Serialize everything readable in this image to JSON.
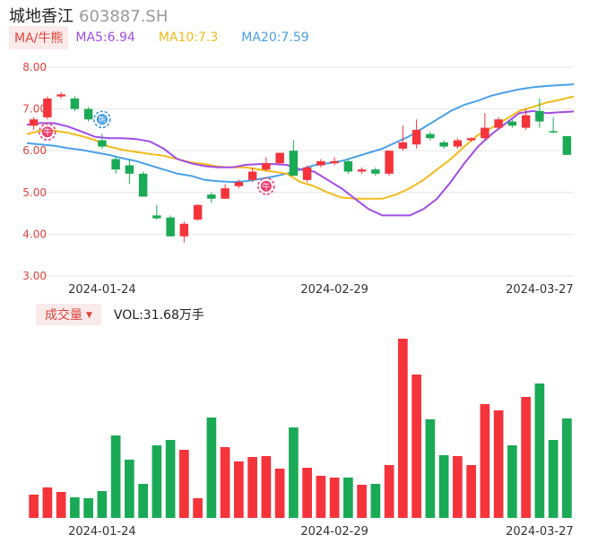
{
  "header": {
    "name": "城地香江",
    "code": "603887.SH",
    "ma_selector": "MA/牛熊",
    "ma5_label": "MA5:6.94",
    "ma10_label": "MA10:7.3",
    "ma20_label": "MA20:7.59"
  },
  "volume_panel": {
    "selector": "成交量",
    "value_label": "VOL:31.68万手"
  },
  "colors": {
    "up": "#f5333b",
    "down": "#1aaa55",
    "ma5": "#a24de6",
    "ma10": "#f2bb1b",
    "ma20": "#4aa0e8",
    "grid": "#e6e6e6",
    "axis_label": "#e0443e"
  },
  "chart_data": {
    "type": "candlestick",
    "y_ticks": [
      "8.00",
      "7.00",
      "6.00",
      "5.00",
      "4.00",
      "3.00"
    ],
    "ylim": [
      3.0,
      8.0
    ],
    "x_tick_labels": [
      "2024-01-24",
      "2024-02-29",
      "2024-03-27"
    ],
    "x_tick_index": [
      5,
      22,
      37
    ],
    "candles": [
      {
        "o": 6.6,
        "c": 6.75,
        "h": 6.8,
        "l": 6.5
      },
      {
        "o": 6.8,
        "c": 7.25,
        "h": 7.3,
        "l": 6.75
      },
      {
        "o": 7.3,
        "c": 7.35,
        "h": 7.4,
        "l": 7.25
      },
      {
        "o": 7.25,
        "c": 7.0,
        "h": 7.3,
        "l": 6.95
      },
      {
        "o": 7.0,
        "c": 6.75,
        "h": 7.05,
        "l": 6.7
      },
      {
        "o": 6.25,
        "c": 6.1,
        "h": 6.4,
        "l": 6.05
      },
      {
        "o": 5.8,
        "c": 5.55,
        "h": 5.85,
        "l": 5.45
      },
      {
        "o": 5.65,
        "c": 5.45,
        "h": 5.8,
        "l": 5.2
      },
      {
        "o": 5.45,
        "c": 4.9,
        "h": 5.5,
        "l": 4.9
      },
      {
        "o": 4.45,
        "c": 4.38,
        "h": 4.7,
        "l": 4.35
      },
      {
        "o": 4.4,
        "c": 3.95,
        "h": 4.45,
        "l": 3.95
      },
      {
        "o": 3.95,
        "c": 4.25,
        "h": 4.3,
        "l": 3.8
      },
      {
        "o": 4.35,
        "c": 4.7,
        "h": 4.72,
        "l": 4.33
      },
      {
        "o": 4.95,
        "c": 4.85,
        "h": 5.0,
        "l": 4.75
      },
      {
        "o": 4.85,
        "c": 5.1,
        "h": 5.2,
        "l": 4.85
      },
      {
        "o": 5.15,
        "c": 5.25,
        "h": 5.3,
        "l": 5.1
      },
      {
        "o": 5.3,
        "c": 5.5,
        "h": 5.6,
        "l": 5.25
      },
      {
        "o": 5.55,
        "c": 5.7,
        "h": 5.85,
        "l": 5.5
      },
      {
        "o": 5.7,
        "c": 5.95,
        "h": 5.95,
        "l": 5.65
      },
      {
        "o": 6.0,
        "c": 5.4,
        "h": 6.25,
        "l": 5.4
      },
      {
        "o": 5.3,
        "c": 5.6,
        "h": 5.65,
        "l": 5.25
      },
      {
        "o": 5.65,
        "c": 5.75,
        "h": 5.8,
        "l": 5.6
      },
      {
        "o": 5.7,
        "c": 5.75,
        "h": 5.85,
        "l": 5.65
      },
      {
        "o": 5.75,
        "c": 5.5,
        "h": 5.8,
        "l": 5.45
      },
      {
        "o": 5.5,
        "c": 5.55,
        "h": 5.6,
        "l": 5.45
      },
      {
        "o": 5.55,
        "c": 5.45,
        "h": 5.6,
        "l": 5.4
      },
      {
        "o": 5.45,
        "c": 6.0,
        "h": 6.0,
        "l": 5.4
      },
      {
        "o": 6.05,
        "c": 6.2,
        "h": 6.6,
        "l": 6.0
      },
      {
        "o": 6.15,
        "c": 6.5,
        "h": 6.75,
        "l": 6.05
      },
      {
        "o": 6.4,
        "c": 6.3,
        "h": 6.45,
        "l": 6.25
      },
      {
        "o": 6.2,
        "c": 6.1,
        "h": 6.25,
        "l": 6.05
      },
      {
        "o": 6.1,
        "c": 6.25,
        "h": 6.3,
        "l": 6.05
      },
      {
        "o": 6.25,
        "c": 6.3,
        "h": 6.32,
        "l": 6.22
      },
      {
        "o": 6.3,
        "c": 6.55,
        "h": 6.9,
        "l": 6.25
      },
      {
        "o": 6.55,
        "c": 6.75,
        "h": 6.8,
        "l": 6.5
      },
      {
        "o": 6.7,
        "c": 6.6,
        "h": 6.75,
        "l": 6.55
      },
      {
        "o": 6.55,
        "c": 6.85,
        "h": 7.0,
        "l": 6.5
      },
      {
        "o": 6.95,
        "c": 6.7,
        "h": 7.25,
        "l": 6.55
      },
      {
        "o": 6.47,
        "c": 6.45,
        "h": 6.8,
        "l": 6.42
      },
      {
        "o": 6.35,
        "c": 5.9,
        "h": 6.35,
        "l": 5.9
      }
    ],
    "ma5": [
      6.62,
      6.66,
      6.66,
      6.58,
      6.46,
      6.33,
      6.3,
      6.3,
      6.28,
      6.22,
      6.05,
      5.8,
      5.7,
      5.63,
      5.6,
      5.6,
      5.66,
      5.68,
      5.68,
      5.66,
      5.55,
      5.5,
      5.3,
      5.1,
      4.85,
      4.6,
      4.45,
      4.45,
      4.45,
      4.6,
      4.85,
      5.25,
      5.7,
      6.1,
      6.4,
      6.65,
      6.9,
      6.95,
      6.9,
      6.92,
      6.94
    ],
    "ma10": [
      6.4,
      6.48,
      6.48,
      6.43,
      6.35,
      6.25,
      6.1,
      6.02,
      5.97,
      5.92,
      5.88,
      5.8,
      5.72,
      5.68,
      5.62,
      5.6,
      5.6,
      5.55,
      5.5,
      5.45,
      5.25,
      5.15,
      5.0,
      4.88,
      4.85,
      4.85,
      4.85,
      4.95,
      5.1,
      5.3,
      5.55,
      5.8,
      6.1,
      6.38,
      6.55,
      6.75,
      6.95,
      7.05,
      7.15,
      7.22,
      7.3
    ],
    "ma20": [
      6.18,
      6.15,
      6.12,
      6.06,
      6.02,
      5.96,
      5.9,
      5.82,
      5.75,
      5.65,
      5.55,
      5.45,
      5.4,
      5.3,
      5.27,
      5.25,
      5.27,
      5.32,
      5.38,
      5.45,
      5.55,
      5.65,
      5.7,
      5.75,
      5.85,
      5.95,
      6.05,
      6.2,
      6.35,
      6.55,
      6.75,
      6.95,
      7.1,
      7.2,
      7.32,
      7.4,
      7.47,
      7.52,
      7.55,
      7.57,
      7.59
    ],
    "markers": [
      {
        "index": 1,
        "price": 6.45,
        "type": "bull",
        "text": "牛"
      },
      {
        "index": 5,
        "price": 6.75,
        "type": "bear",
        "text": "熊"
      },
      {
        "index": 17,
        "price": 5.15,
        "type": "bull",
        "text": "牛"
      }
    ],
    "volume": {
      "values": [
        26,
        34,
        29,
        23,
        22,
        30,
        92,
        65,
        38,
        81,
        87,
        76,
        22,
        112,
        79,
        63,
        68,
        69,
        55,
        101,
        56,
        47,
        45,
        45,
        37,
        38,
        59,
        200,
        160,
        110,
        70,
        69,
        59,
        127,
        120,
        81,
        135,
        150,
        87,
        111
      ],
      "vmax": 200
    }
  }
}
